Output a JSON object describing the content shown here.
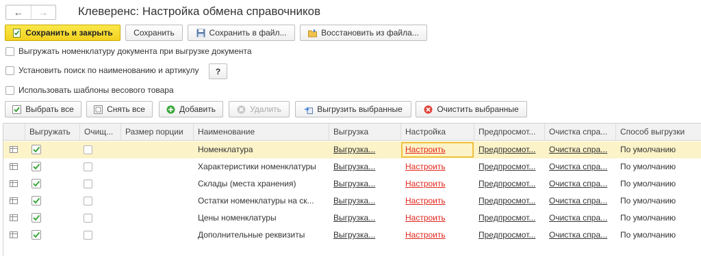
{
  "window": {
    "title": "Клеверенс: Настройка обмена справочников",
    "back_glyph": "←",
    "forward_glyph": "→"
  },
  "toolbar": {
    "save_close": "Сохранить и закрыть",
    "save": "Сохранить",
    "save_file": "Сохранить в файл...",
    "restore_file": "Восстановить из файла..."
  },
  "options": {
    "export_nomenclature": "Выгружать номенклатуру документа при выгрузке документа",
    "search_by_name": "Установить поиск по наименованию и артикулу",
    "help_glyph": "?",
    "weight_templates": "Использовать шаблоны весового товара"
  },
  "grid_toolbar": {
    "select_all": "Выбрать все",
    "deselect_all": "Снять все",
    "add": "Добавить",
    "delete": "Удалить",
    "export_selected": "Выгрузить выбранные",
    "clear_selected": "Очистить выбранные"
  },
  "table": {
    "headers": {
      "export": "Выгружать",
      "clear": "Очищ...",
      "portion": "Размер порции",
      "name": "Наименование",
      "upload": "Выгрузка",
      "settings": "Настройка",
      "preview": "Предпросмот...",
      "clear_ref": "Очистка спра...",
      "method": "Способ выгрузки"
    },
    "rows": [
      {
        "name": "Номенклатура",
        "upload": "Выгрузка...",
        "settings": "Настроить",
        "preview": "Предпросмот...",
        "clear_ref": "Очистка спра...",
        "method": "По умолчанию"
      },
      {
        "name": "Характеристики номенклатуры",
        "upload": "Выгрузка...",
        "settings": "Настроить",
        "preview": "Предпросмот...",
        "clear_ref": "Очистка спра...",
        "method": "По умолчанию"
      },
      {
        "name": "Склады (места хранения)",
        "upload": "Выгрузка...",
        "settings": "Настроить",
        "preview": "Предпросмот...",
        "clear_ref": "Очистка спра...",
        "method": "По умолчанию"
      },
      {
        "name": "Остатки номенклатуры на ск...",
        "upload": "Выгрузка...",
        "settings": "Настроить",
        "preview": "Предпросмот...",
        "clear_ref": "Очистка спра...",
        "method": "По умолчанию"
      },
      {
        "name": "Цены номенклатуры",
        "upload": "Выгрузка...",
        "settings": "Настроить",
        "preview": "Предпросмот...",
        "clear_ref": "Очистка спра...",
        "method": "По умолчанию"
      },
      {
        "name": "Дополнительные реквизиты",
        "upload": "Выгрузка...",
        "settings": "Настроить",
        "preview": "Предпросмот...",
        "clear_ref": "Очистка спра...",
        "method": "По умолчанию"
      }
    ]
  },
  "colors": {
    "primary_button": "#f2d21f",
    "link_red": "#e1261c",
    "check_green": "#3aa83a",
    "selected_row": "#fcf3c8"
  }
}
